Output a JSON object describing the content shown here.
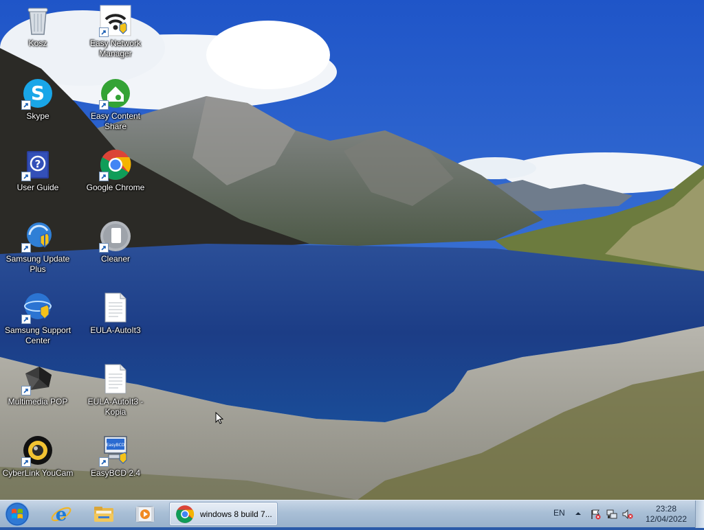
{
  "desktop": {
    "icons": [
      {
        "id": "recycle-bin",
        "label": "Kosz"
      },
      {
        "id": "easy-network-manager",
        "label": "Easy Network Manager"
      },
      {
        "id": "skype",
        "label": "Skype"
      },
      {
        "id": "easy-content-share",
        "label": "Easy Content Share"
      },
      {
        "id": "user-guide",
        "label": "User Guide"
      },
      {
        "id": "google-chrome",
        "label": "Google Chrome"
      },
      {
        "id": "samsung-update-plus",
        "label": "Samsung Update Plus"
      },
      {
        "id": "cleaner",
        "label": "Cleaner"
      },
      {
        "id": "samsung-support-center",
        "label": "Samsung Support Center"
      },
      {
        "id": "eula-autoit3",
        "label": "EULA-AutoIt3"
      },
      {
        "id": "multimedia-pop",
        "label": "Multimedia POP"
      },
      {
        "id": "eula-autoit3-kopia",
        "label": "EULA-AutoIt3 - Kopia"
      },
      {
        "id": "cyberlink-youcam",
        "label": "CyberLink YouCam"
      },
      {
        "id": "easybcd",
        "label": "EasyBCD 2.4"
      }
    ]
  },
  "taskbar": {
    "pinned": [
      {
        "icon": "internet-explorer-icon"
      },
      {
        "icon": "file-explorer-icon"
      },
      {
        "icon": "media-player-icon"
      }
    ],
    "open_window": {
      "icon": "chrome-icon",
      "title": "windows 8 build 7..."
    },
    "tray": {
      "language": "EN",
      "icons": [
        "action-center-flag-icon",
        "network-icon",
        "volume-muted-icon"
      ]
    },
    "clock": {
      "time": "23:28",
      "date": "12/04/2022"
    }
  },
  "colors": {
    "sky": "#2a5fc4",
    "lake": "#1d3f86",
    "taskbar": "#a9bfd6"
  }
}
